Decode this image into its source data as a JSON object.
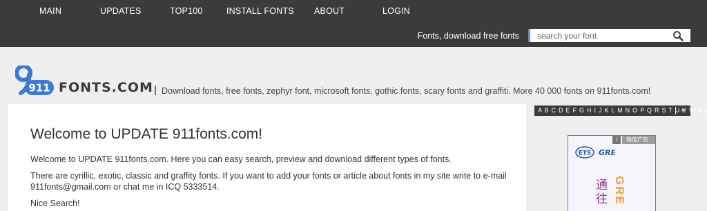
{
  "nav": {
    "items": [
      "MAIN",
      "UPDATES",
      "TOP100",
      "INSTALL FONTS",
      "ABOUT",
      "LOGIN"
    ]
  },
  "header": {
    "tagline": "Fonts, download free fonts",
    "search_placeholder": "search your font"
  },
  "brand": {
    "logo_number": "911",
    "logo_text": "FONTS.COM",
    "description": "Download fonts, free fonts, zephyr font, microsoft fonts, gothic fonts, scary fonts and graffiti. More 40 000 fonts on 911fonts.com!"
  },
  "main": {
    "title": "Welcome to UPDATE 911fonts.com!",
    "paragraphs": [
      "Welcome to UPDATE 911fonts.com. Here you can easy search, preview and download different types of fonts.",
      "There are cyrillic, exotic, classic and graffity fonts. If you want to add your fonts or article about fonts in my site write to e-mail 911fonts@gmail.com or chat me in ICQ 5333514.",
      "Nice Search!"
    ]
  },
  "alphabet": {
    "letters": "A B C D E F G H I J K L M N O P Q R S T U V W X Y Z",
    "hash": "#"
  },
  "ad": {
    "label": "微信广告",
    "info": "i",
    "ets": "ETS",
    "gre": "GRE",
    "cn_text": "通往",
    "side_text": "GRE"
  },
  "colors": {
    "topbar": "#3b3b3b",
    "search_accent": "#5a8fd1",
    "logo_blue": "#3a7bd5",
    "ad_purple": "#8a3aa0",
    "ad_orange": "#f2a03a"
  },
  "icons": {
    "search": "magnifier-icon",
    "logo": "911-badge-icon"
  }
}
